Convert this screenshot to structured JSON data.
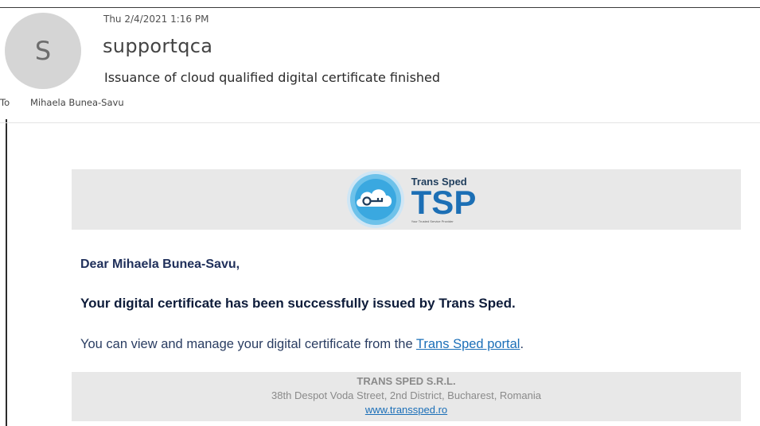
{
  "header": {
    "avatar_initial": "S",
    "date": "Thu 2/4/2021 1:16 PM",
    "sender": "supportqca",
    "subject": "Issuance of cloud qualified digital certificate finished",
    "to_label": "To",
    "recipient": "Mihaela Bunea-Savu"
  },
  "banner": {
    "brand_name": "Trans Sped",
    "brand_abbr": "TSP",
    "tagline": "Your Trusted Service Provider",
    "logo_icon": "cloud-key-icon"
  },
  "body": {
    "greeting": "Dear Mihaela Bunea-Savu,",
    "headline": "Your digital certificate has been successfully issued by Trans Sped.",
    "text_before_link": "You can view and manage your digital certificate from the ",
    "link_text": "Trans Sped portal",
    "text_after_link": "."
  },
  "footer": {
    "company": "TRANS SPED S.R.L.",
    "address": "38th Despot Voda Street, 2nd District, Bucharest, Romania",
    "website": "www.transsped.ro"
  },
  "colors": {
    "accent": "#1c6fb5",
    "link": "#1b6fb8",
    "banner_bg": "#e8e8e8",
    "avatar_bg": "#d5d5d5"
  }
}
